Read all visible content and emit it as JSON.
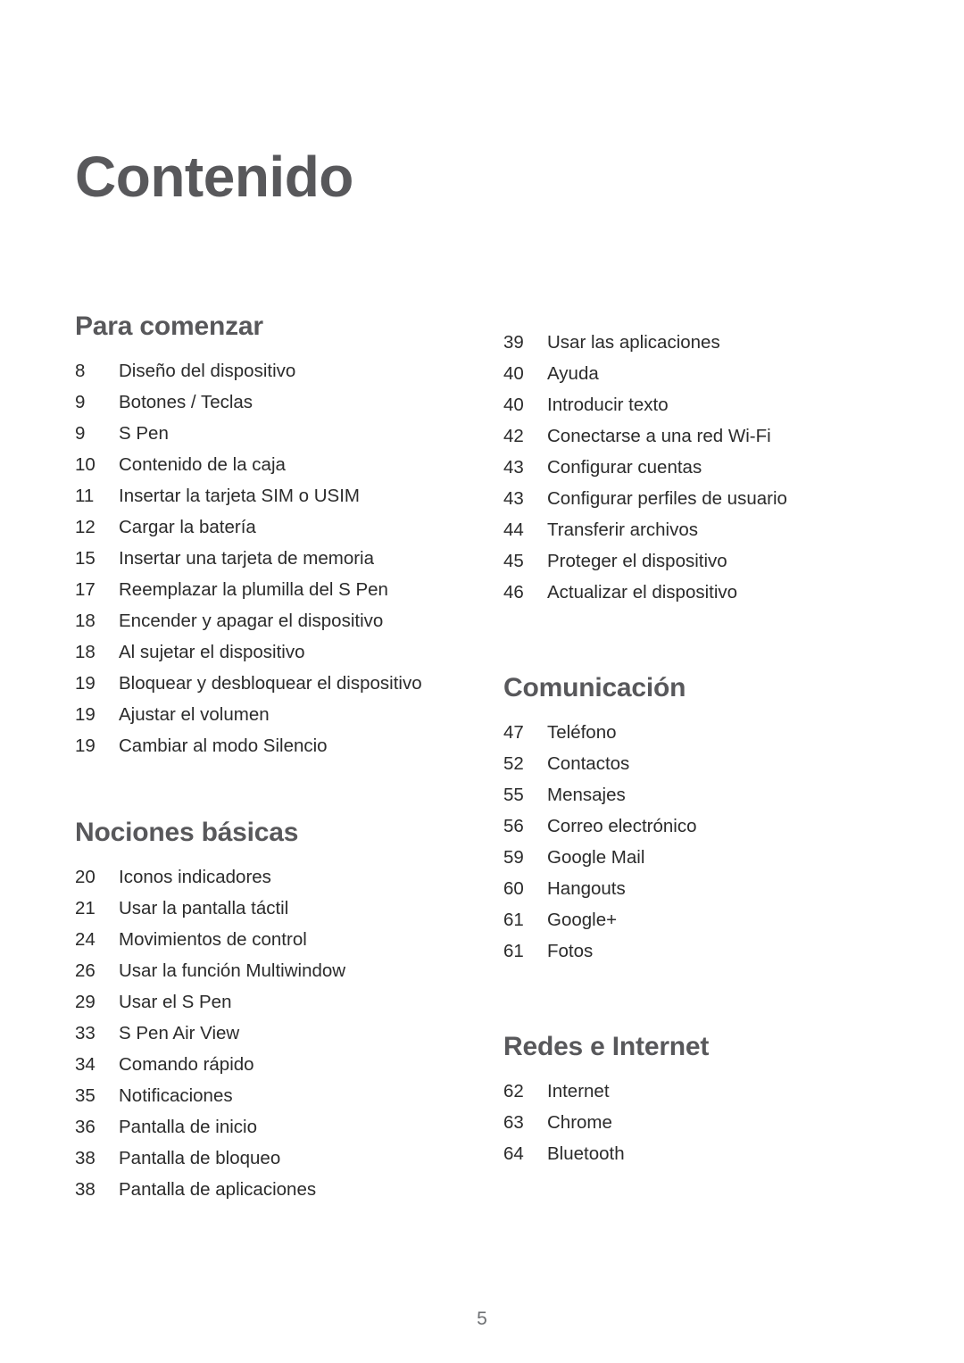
{
  "document": {
    "title": "Contenido",
    "page_number": "5"
  },
  "colors": {
    "heading": "#58585b",
    "body": "#2b2b2b",
    "page_number": "#6e7073",
    "background": "#ffffff"
  },
  "columns": [
    {
      "id": "left",
      "sections": [
        {
          "heading": "Para comenzar",
          "entries": [
            {
              "page": "8",
              "title": "Diseño del dispositivo"
            },
            {
              "page": "9",
              "title": "Botones / Teclas"
            },
            {
              "page": "9",
              "title": "S Pen"
            },
            {
              "page": "10",
              "title": "Contenido de la caja"
            },
            {
              "page": "11",
              "title": "Insertar la tarjeta SIM o USIM"
            },
            {
              "page": "12",
              "title": "Cargar la batería"
            },
            {
              "page": "15",
              "title": "Insertar una tarjeta de memoria"
            },
            {
              "page": "17",
              "title": "Reemplazar la plumilla del S Pen"
            },
            {
              "page": "18",
              "title": "Encender y apagar el dispositivo"
            },
            {
              "page": "18",
              "title": "Al sujetar el dispositivo"
            },
            {
              "page": "19",
              "title": "Bloquear y desbloquear el dispositivo"
            },
            {
              "page": "19",
              "title": "Ajustar el volumen"
            },
            {
              "page": "19",
              "title": "Cambiar al modo Silencio"
            }
          ]
        },
        {
          "heading": "Nociones básicas",
          "entries": [
            {
              "page": "20",
              "title": "Iconos indicadores"
            },
            {
              "page": "21",
              "title": "Usar la pantalla táctil"
            },
            {
              "page": "24",
              "title": "Movimientos de control"
            },
            {
              "page": "26",
              "title": "Usar la función Multiwindow"
            },
            {
              "page": "29",
              "title": "Usar el S Pen"
            },
            {
              "page": "33",
              "title": "S Pen Air View"
            },
            {
              "page": "34",
              "title": "Comando rápido"
            },
            {
              "page": "35",
              "title": "Notificaciones"
            },
            {
              "page": "36",
              "title": "Pantalla de inicio"
            },
            {
              "page": "38",
              "title": "Pantalla de bloqueo"
            },
            {
              "page": "38",
              "title": "Pantalla de aplicaciones"
            }
          ]
        }
      ]
    },
    {
      "id": "right",
      "sections": [
        {
          "heading": "",
          "entries": [
            {
              "page": "39",
              "title": "Usar las aplicaciones"
            },
            {
              "page": "40",
              "title": "Ayuda"
            },
            {
              "page": "40",
              "title": "Introducir texto"
            },
            {
              "page": "42",
              "title": "Conectarse a una red Wi-Fi"
            },
            {
              "page": "43",
              "title": "Configurar cuentas"
            },
            {
              "page": "43",
              "title": "Configurar perfiles de usuario"
            },
            {
              "page": "44",
              "title": "Transferir archivos"
            },
            {
              "page": "45",
              "title": "Proteger el dispositivo"
            },
            {
              "page": "46",
              "title": "Actualizar el dispositivo"
            }
          ]
        },
        {
          "heading": "Comunicación",
          "entries": [
            {
              "page": "47",
              "title": "Teléfono"
            },
            {
              "page": "52",
              "title": "Contactos"
            },
            {
              "page": "55",
              "title": "Mensajes"
            },
            {
              "page": "56",
              "title": "Correo electrónico"
            },
            {
              "page": "59",
              "title": "Google Mail"
            },
            {
              "page": "60",
              "title": "Hangouts"
            },
            {
              "page": "61",
              "title": "Google+"
            },
            {
              "page": "61",
              "title": "Fotos"
            }
          ]
        },
        {
          "heading": "Redes e Internet",
          "entries": [
            {
              "page": "62",
              "title": "Internet"
            },
            {
              "page": "63",
              "title": "Chrome"
            },
            {
              "page": "64",
              "title": "Bluetooth"
            }
          ]
        }
      ]
    }
  ]
}
